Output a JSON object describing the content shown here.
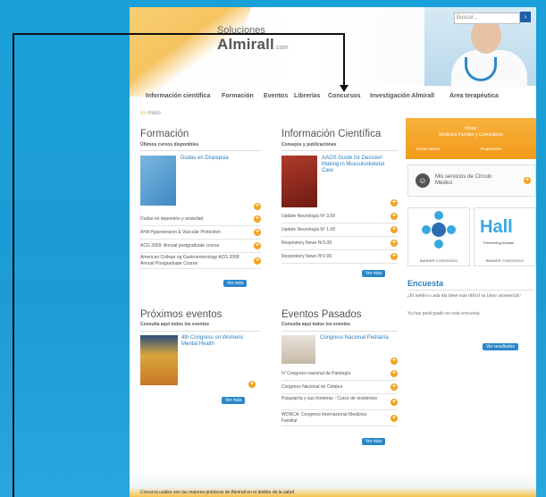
{
  "header": {
    "brand_line1": "Soluciones",
    "brand_line2": "Almirall",
    "brand_suffix": ".com",
    "search_placeholder": "Buscar...",
    "search_go": "›"
  },
  "nav": {
    "items": [
      "Información científica",
      "Formación",
      "Eventos",
      "Librerías",
      "Concursos",
      "Investigación Almirall",
      "Área terapéutica"
    ]
  },
  "breadcrumb": {
    "arrow": ">>",
    "label": "Inicio"
  },
  "formacion": {
    "title": "Formación",
    "subtitle": "Últimos cursos disponibles",
    "featured": "Dudas en Dispepsia",
    "items": [
      "Dudas en depresión y ansiedad",
      "AHA Hypertension & Vascular Protection",
      "ACG 2009: Annual postgraduate course",
      "American College og Gastroenterology ACG 2008 Annual Postgraduate Course"
    ],
    "more": "Ver más"
  },
  "informacion": {
    "title": "Información Científica",
    "subtitle": "Consejos y publicaciones",
    "featured": "AAOS Guide for Decision Making in Musculoskeletal Care",
    "items": [
      "Update Neurología Nº 3.09",
      "Update Neurología Nº 1.09",
      "Respiratory News Nº3.09",
      "Respiratory News Nº2.09"
    ],
    "more": "Ver más"
  },
  "proximos": {
    "title": "Próximos eventos",
    "subtitle": "Consulta aquí todos los eventos",
    "featured": "4th Congress on Womens Mental Health",
    "more": "Ver más"
  },
  "pasados": {
    "title": "Eventos Pasados",
    "subtitle": "Consulta aquí todos los eventos",
    "featured": "Congreso Nacional Pediatría",
    "items": [
      "IV Congreso nacional de Patología",
      "Congreso Nacional de Cefalea",
      "Psiquiatría y sus fronteras - Curso de residentes",
      "WONCA: Congreso Internacional Medicina Familiar"
    ],
    "more": "Ver más"
  },
  "sidebar": {
    "login_line1": "Iniciar",
    "login_line2": "Medicina Familiar y Comunitaria",
    "login_btn1": "Iniciar sesión",
    "login_btn2": "Registrarse",
    "services": "Mis servicios de Círculo Médico",
    "banner1_caption": "BANNER CONCEDIDO",
    "banner2_logo": "Hall",
    "banner2_sub": "Prescribing Almirall",
    "banner2_caption": "BANNER CONCEDIDO",
    "encuesta_title": "Encuesta",
    "encuesta_q": "¿El médico cada día tiene más difícil su labor asistencial?",
    "encuesta_a": "Ya has participado en esta encuesta",
    "encuesta_more": "Ver resultados"
  },
  "footer": {
    "text": "Conozca cuáles son las mejores prácticas de Almirall en el ámbito de la salud"
  }
}
